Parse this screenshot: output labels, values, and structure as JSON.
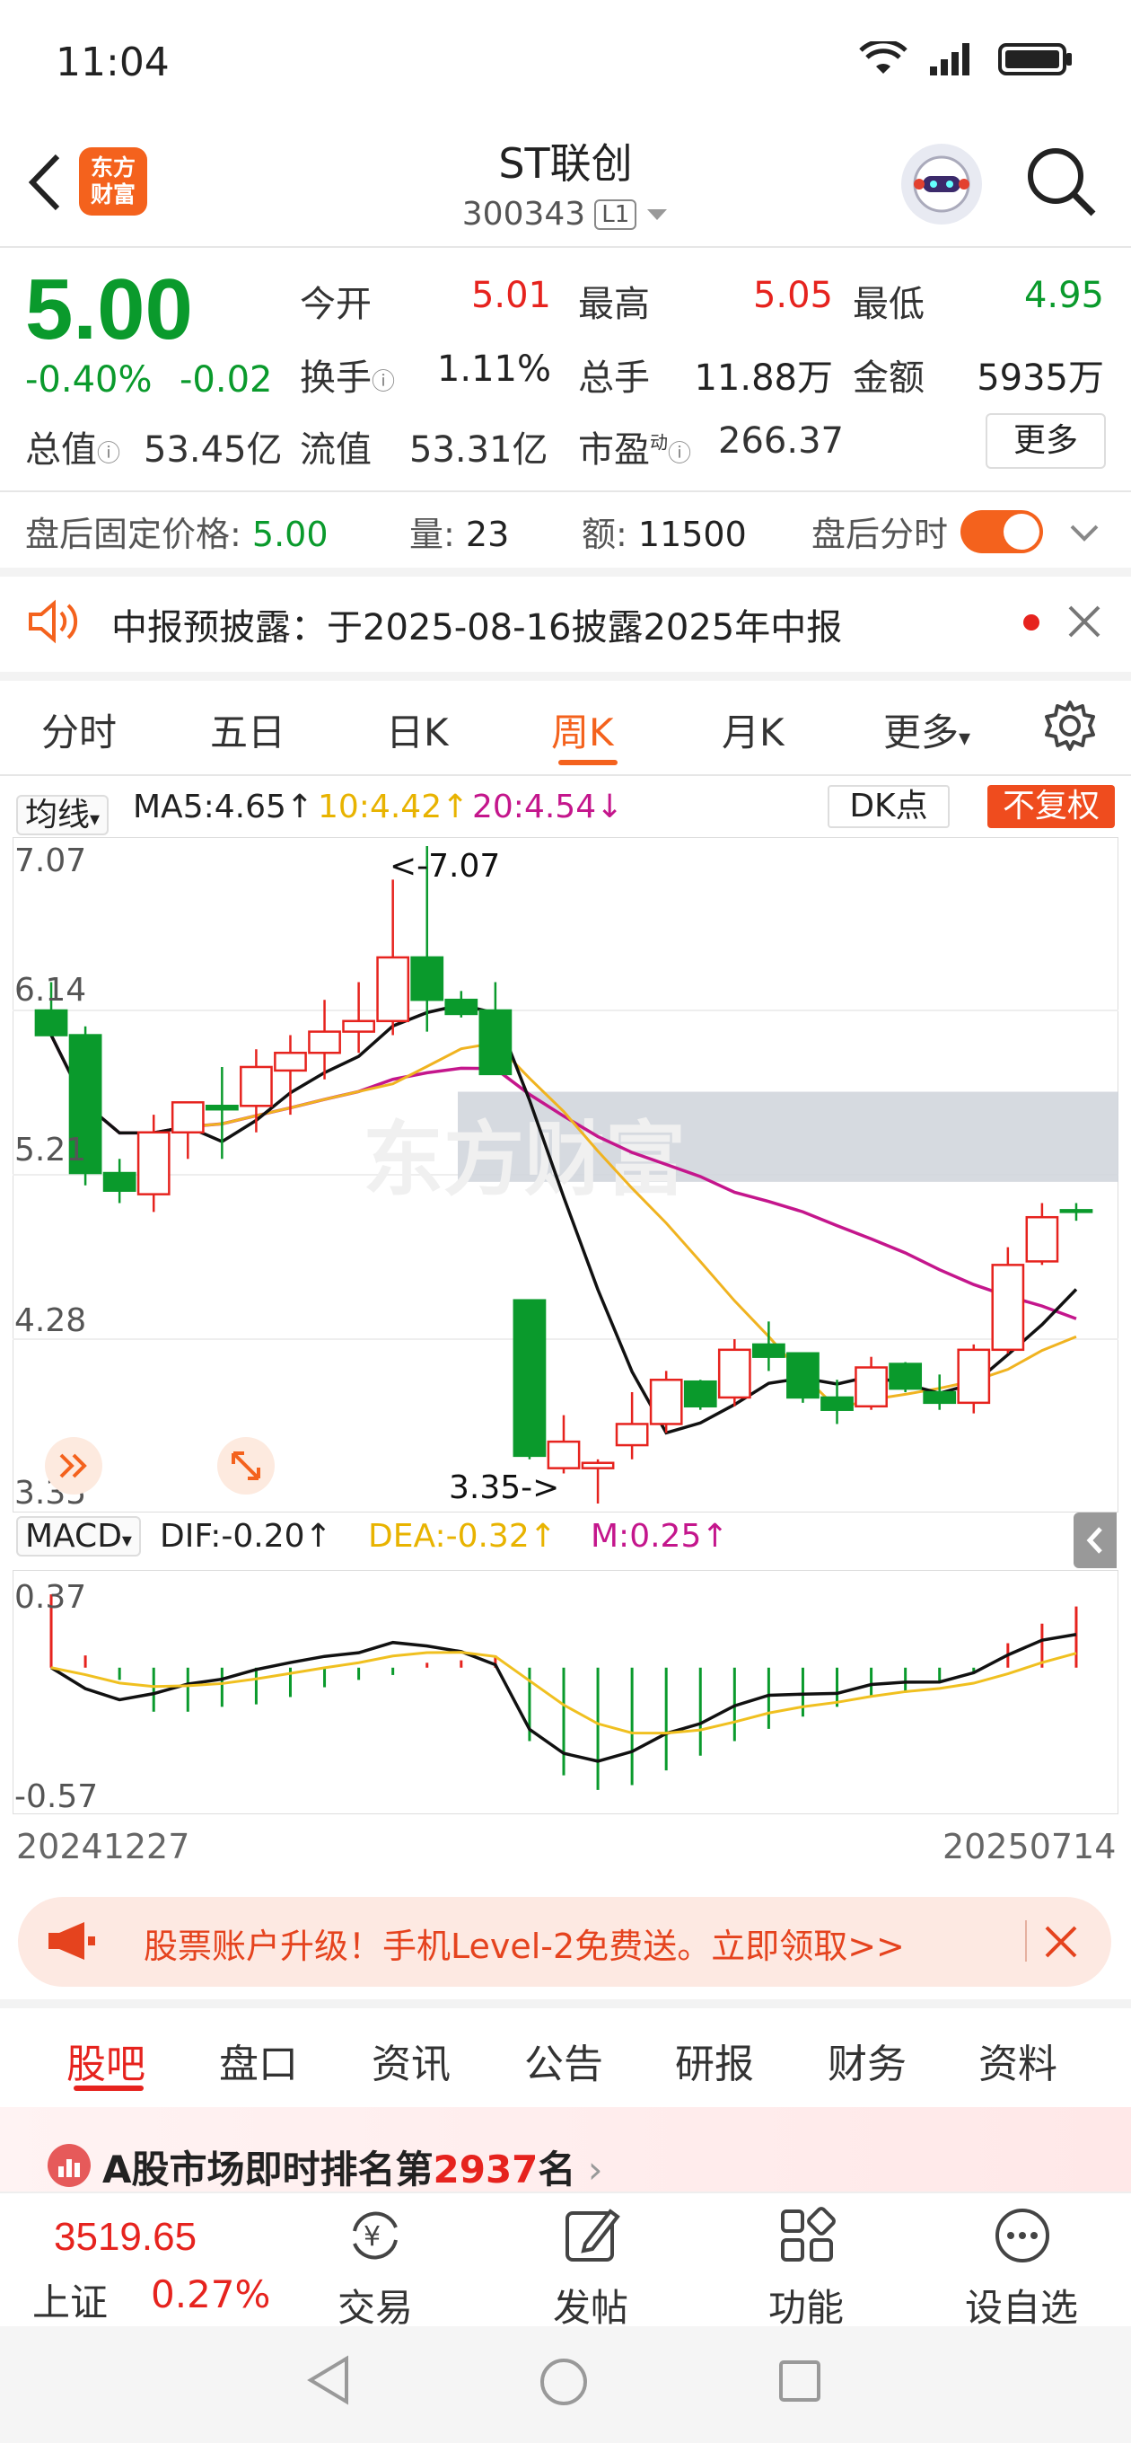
{
  "status": {
    "time": "11:04"
  },
  "header": {
    "title": "ST联创",
    "code": "300343",
    "level_badge": "L1",
    "logo_line1": "东方",
    "logo_line2": "财富"
  },
  "quote": {
    "price": "5.00",
    "change_pct": "-0.40%",
    "change": "-0.02",
    "open_label": "今开",
    "open": "5.01",
    "high_label": "最高",
    "high": "5.05",
    "low_label": "最低",
    "low": "4.95",
    "turnover_label": "换手",
    "turnover": "1.11%",
    "volume_label": "总手",
    "volume": "11.88万",
    "amount_label": "金额",
    "amount": "5935万",
    "mktcap_label": "总值",
    "mktcap": "53.45亿",
    "float_label": "流值",
    "float": "53.31亿",
    "pe_label": "市盈",
    "pe_sup": "动",
    "pe": "266.37",
    "more_label": "更多"
  },
  "after_hours": {
    "price_label": "盘后固定价格:",
    "price": "5.00",
    "vol_label": "量:",
    "vol": "23",
    "amt_label": "额:",
    "amt": "11500",
    "timeshare_label": "盘后分时"
  },
  "notice": {
    "text": "中报预披露：于2025-08-16披露2025年中报"
  },
  "chart_tabs": [
    "分时",
    "五日",
    "日K",
    "周K",
    "月K",
    "更多"
  ],
  "ma": {
    "selector": "均线",
    "ma5": "MA5:4.65↑",
    "ma10": "10:4.42↑",
    "ma20": "20:4.54↓",
    "dk": "DK点",
    "adjust": "不复权"
  },
  "macd": {
    "selector": "MACD",
    "dif": "DIF:-0.20↑",
    "dea": "DEA:-0.32↑",
    "m": "M:0.25↑"
  },
  "axis": {
    "y1": "7.07",
    "y2": "6.14",
    "y3": "5.21",
    "y4": "4.28",
    "y5": "3.35",
    "macd_top": "0.37",
    "macd_bottom": "-0.57",
    "date_start": "20241227",
    "date_end": "20250714",
    "hi_mark": "<-7.07",
    "lo_mark": "3.35->"
  },
  "chart_data": {
    "type": "candlestick",
    "ylim": [
      3.35,
      7.07
    ],
    "candles": [
      {
        "o": 6.14,
        "h": 6.3,
        "l": 6.0,
        "c": 6.0
      },
      {
        "o": 6.0,
        "h": 6.05,
        "l": 5.15,
        "c": 5.22
      },
      {
        "o": 5.22,
        "h": 5.3,
        "l": 5.05,
        "c": 5.12
      },
      {
        "o": 5.1,
        "h": 5.55,
        "l": 5.0,
        "c": 5.45
      },
      {
        "o": 5.45,
        "h": 5.62,
        "l": 5.3,
        "c": 5.62
      },
      {
        "o": 5.6,
        "h": 5.82,
        "l": 5.3,
        "c": 5.58
      },
      {
        "o": 5.6,
        "h": 5.92,
        "l": 5.45,
        "c": 5.82
      },
      {
        "o": 5.8,
        "h": 6.0,
        "l": 5.55,
        "c": 5.9
      },
      {
        "o": 5.9,
        "h": 6.2,
        "l": 5.75,
        "c": 6.02
      },
      {
        "o": 6.02,
        "h": 6.3,
        "l": 5.9,
        "c": 6.08
      },
      {
        "o": 6.08,
        "h": 6.88,
        "l": 6.0,
        "c": 6.44
      },
      {
        "o": 6.44,
        "h": 7.07,
        "l": 6.02,
        "c": 6.2
      },
      {
        "o": 6.2,
        "h": 6.25,
        "l": 6.1,
        "c": 6.12
      },
      {
        "o": 6.14,
        "h": 6.3,
        "l": 5.78,
        "c": 5.78
      },
      {
        "o": 4.5,
        "h": 4.5,
        "l": 3.6,
        "c": 3.62
      },
      {
        "o": 3.55,
        "h": 3.85,
        "l": 3.52,
        "c": 3.7
      },
      {
        "o": 3.55,
        "h": 3.6,
        "l": 3.35,
        "c": 3.58
      },
      {
        "o": 3.68,
        "h": 3.98,
        "l": 3.6,
        "c": 3.8
      },
      {
        "o": 3.8,
        "h": 4.1,
        "l": 3.75,
        "c": 4.05
      },
      {
        "o": 4.04,
        "h": 4.05,
        "l": 3.88,
        "c": 3.9
      },
      {
        "o": 3.95,
        "h": 4.28,
        "l": 3.9,
        "c": 4.22
      },
      {
        "o": 4.25,
        "h": 4.38,
        "l": 4.1,
        "c": 4.18
      },
      {
        "o": 4.2,
        "h": 4.2,
        "l": 3.92,
        "c": 3.95
      },
      {
        "o": 3.95,
        "h": 4.05,
        "l": 3.8,
        "c": 3.88
      },
      {
        "o": 3.9,
        "h": 4.18,
        "l": 3.88,
        "c": 4.12
      },
      {
        "o": 4.14,
        "h": 4.15,
        "l": 3.98,
        "c": 4.0
      },
      {
        "o": 3.98,
        "h": 4.08,
        "l": 3.88,
        "c": 3.92
      },
      {
        "o": 3.92,
        "h": 4.25,
        "l": 3.86,
        "c": 4.22
      },
      {
        "o": 4.22,
        "h": 4.8,
        "l": 4.2,
        "c": 4.7
      },
      {
        "o": 4.72,
        "h": 5.05,
        "l": 4.7,
        "c": 4.97
      },
      {
        "o": 5.01,
        "h": 5.05,
        "l": 4.95,
        "c": 5.0
      }
    ],
    "macd_bars": [
      0.3,
      0.05,
      -0.05,
      -0.18,
      -0.18,
      -0.16,
      -0.15,
      -0.12,
      -0.08,
      -0.05,
      -0.03,
      0.02,
      0.03,
      0.05,
      -0.3,
      -0.44,
      -0.5,
      -0.48,
      -0.42,
      -0.36,
      -0.3,
      -0.25,
      -0.2,
      -0.16,
      -0.12,
      -0.1,
      -0.06,
      -0.02,
      0.1,
      0.18,
      0.25
    ],
    "macd_ylim": [
      -0.57,
      0.37
    ],
    "gap_zone": [
      5.17,
      5.68
    ]
  },
  "promo": {
    "text": "股票账户升级！手机Level-2免费送。立即领取>>"
  },
  "lower_tabs": [
    "股吧",
    "盘口",
    "资讯",
    "公告",
    "研报",
    "财务",
    "资料"
  ],
  "rank": {
    "prefix": "A股市场即时排名第",
    "num": "2937",
    "suffix": "名"
  },
  "index": {
    "value": "3519.65",
    "name": "上证",
    "pct": "0.27%"
  },
  "nav": [
    "交易",
    "发帖",
    "功能",
    "设自选"
  ]
}
